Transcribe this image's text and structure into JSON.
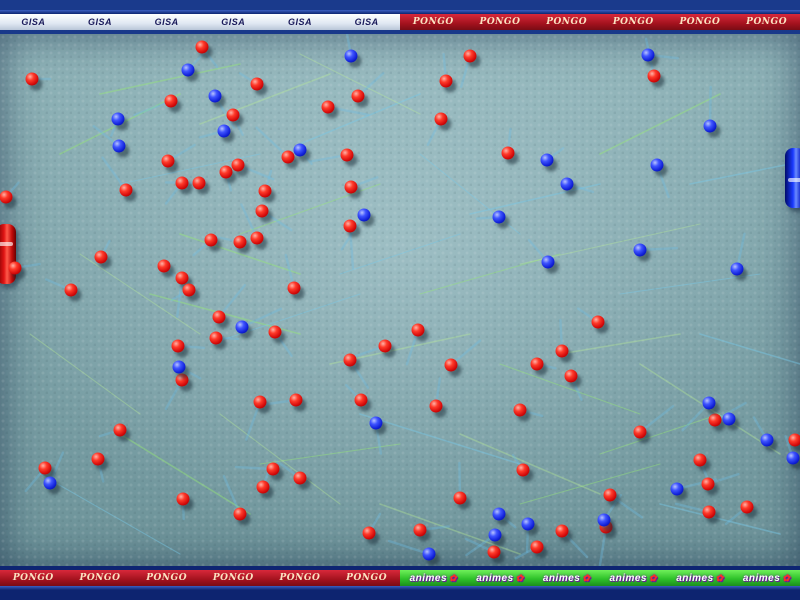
{
  "top_banner": {
    "left_word": "GISA",
    "right_word": "PONGO"
  },
  "bottom_banner": {
    "left_word": "PONGO",
    "right_word": "animes"
  },
  "colors": {
    "red_team": "#e01010",
    "blue_team": "#1a2aff",
    "field": "#7ea3a9",
    "frame": "#0d2470"
  },
  "goals": [
    {
      "team": "red",
      "side": "left"
    },
    {
      "team": "blue",
      "side": "right"
    }
  ],
  "red_ball_count": 77,
  "blue_ball_count": 31
}
